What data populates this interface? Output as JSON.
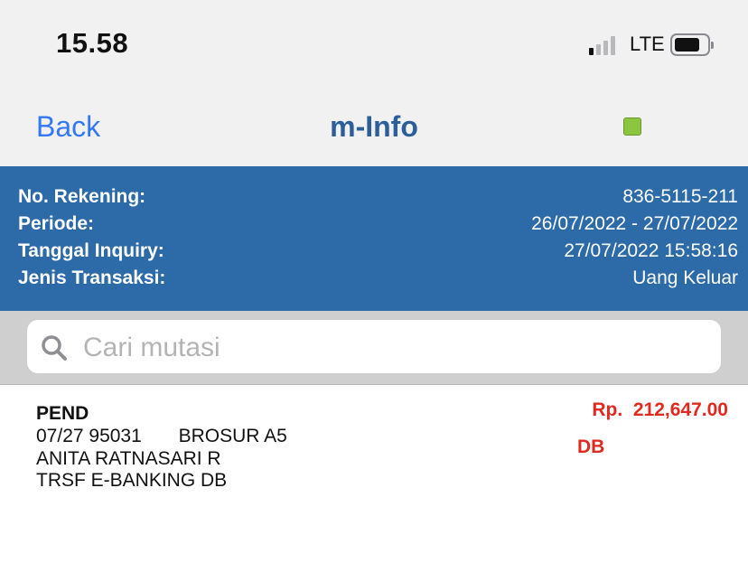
{
  "status_bar": {
    "time": "15.58",
    "network": "LTE",
    "signal_bars_active": 1,
    "signal_bars_total": 4
  },
  "nav": {
    "back_label": "Back",
    "title": "m-Info",
    "status_color": "#8cc63e"
  },
  "account_info": {
    "rows": [
      {
        "label": "No. Rekening:",
        "value": "836-5115-211"
      },
      {
        "label": "Periode:",
        "value": "26/07/2022 - 27/07/2022"
      },
      {
        "label": "Tanggal Inquiry:",
        "value": "27/07/2022 15:58:16"
      },
      {
        "label": "Jenis Transaksi:",
        "value": "Uang Keluar"
      }
    ]
  },
  "search": {
    "placeholder": "Cari mutasi",
    "value": ""
  },
  "transactions": [
    {
      "code": "PEND",
      "line1": "07/27 95031       BROSUR A5",
      "line2": "ANITA RATNASARI R",
      "line3": "TRSF E-BANKING DB",
      "amount": "Rp.  212,647.00",
      "type": "DB"
    }
  ],
  "colors": {
    "header_blue": "#2c6aa8",
    "title_blue": "#2c5e9a",
    "link_blue": "#3478f6",
    "debit_red": "#e02a1f"
  }
}
